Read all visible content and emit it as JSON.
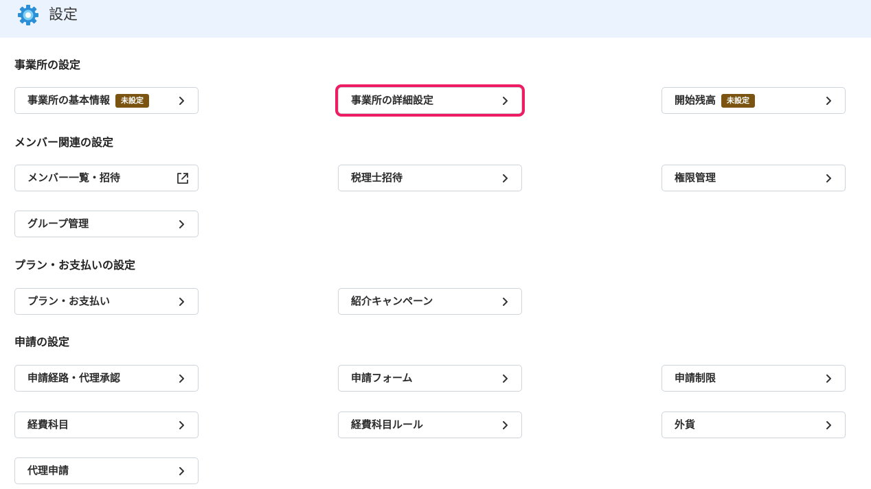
{
  "header": {
    "title": "設定",
    "icon": "gear-icon",
    "accent_color": "#2b8fd8"
  },
  "sections": {
    "office": {
      "title": "事業所の設定",
      "items": [
        {
          "label": "事業所の基本情報",
          "badge": "未設定",
          "icon": "chevron-right-icon"
        },
        {
          "label": "事業所の詳細設定",
          "icon": "chevron-right-icon",
          "highlighted": true
        },
        {
          "label": "開始残高",
          "badge": "未設定",
          "icon": "chevron-right-icon"
        }
      ]
    },
    "members": {
      "title": "メンバー関連の設定",
      "items": [
        {
          "label": "メンバー一覧・招待",
          "icon": "external-link-icon"
        },
        {
          "label": "税理士招待",
          "icon": "chevron-right-icon"
        },
        {
          "label": "権限管理",
          "icon": "chevron-right-icon"
        },
        {
          "label": "グループ管理",
          "icon": "chevron-right-icon"
        }
      ]
    },
    "plan": {
      "title": "プラン・お支払いの設定",
      "items": [
        {
          "label": "プラン・お支払い",
          "icon": "chevron-right-icon"
        },
        {
          "label": "紹介キャンペーン",
          "icon": "chevron-right-icon"
        }
      ]
    },
    "application": {
      "title": "申請の設定",
      "items": [
        {
          "label": "申請経路・代理承認",
          "icon": "chevron-right-icon"
        },
        {
          "label": "申請フォーム",
          "icon": "chevron-right-icon"
        },
        {
          "label": "申請制限",
          "icon": "chevron-right-icon"
        },
        {
          "label": "経費科目",
          "icon": "chevron-right-icon"
        },
        {
          "label": "経費科目ルール",
          "icon": "chevron-right-icon"
        },
        {
          "label": "外貨",
          "icon": "chevron-right-icon"
        },
        {
          "label": "代理申請",
          "icon": "chevron-right-icon"
        }
      ]
    }
  },
  "colors": {
    "header_bg": "#eaf3fe",
    "badge_bg": "#7a5410",
    "highlight": "#ee1d63",
    "card_border": "#cfd4db"
  }
}
